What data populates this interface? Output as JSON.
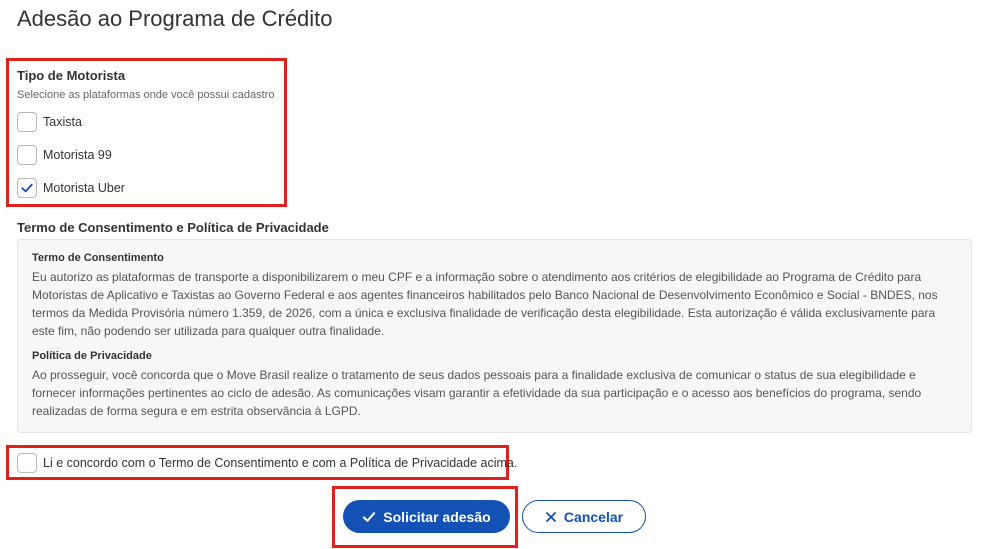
{
  "page": {
    "title": "Adesão ao Programa de Crédito"
  },
  "tipo_motorista": {
    "label": "Tipo de Motorista",
    "hint": "Selecione as plataformas onde você possui cadastro",
    "options": [
      {
        "label": "Taxista",
        "checked": false
      },
      {
        "label": "Motorista 99",
        "checked": false
      },
      {
        "label": "Motorista Uber",
        "checked": true
      }
    ]
  },
  "terms": {
    "section_label": "Termo de Consentimento e Política de Privacidade",
    "consent_title": "Termo de Consentimento",
    "consent_text": "Eu autorizo as plataformas de transporte a disponibilizarem o meu CPF e a informação sobre o atendimento aos critérios de elegibilidade ao Programa de Crédito para Motoristas de Aplicativo e Taxistas ao Governo Federal e aos agentes financeiros habilitados pelo Banco Nacional de Desenvolvimento Econômico e Social - BNDES, nos termos da Medida Provisória número 1.359, de 2026, com a única e exclusiva finalidade de verificação desta elegibilidade. Esta autorização é válida exclusivamente para este fim, não podendo ser utilizada para qualquer outra finalidade.",
    "privacy_title": "Política de Privacidade",
    "privacy_text": "Ao prosseguir, você concorda que o Move Brasil realize o tratamento de seus dados pessoais para a finalidade exclusiva de comunicar o status de sua elegibilidade e fornecer informações pertinentes ao ciclo de adesão. As comunicações visam garantir a efetividade da sua participação e o acesso aos benefícios do programa, sendo realizadas de forma segura e em estrita observância à LGPD."
  },
  "agreement": {
    "label": "Li e concordo com o Termo de Consentimento e com a Política de Privacidade acima.",
    "checked": false
  },
  "actions": {
    "submit_label": "Solicitar adesão",
    "cancel_label": "Cancelar"
  },
  "colors": {
    "primary": "#1351b4",
    "highlight": "#e0201b"
  },
  "icons": {
    "submit": "check-icon",
    "cancel": "close-icon"
  }
}
